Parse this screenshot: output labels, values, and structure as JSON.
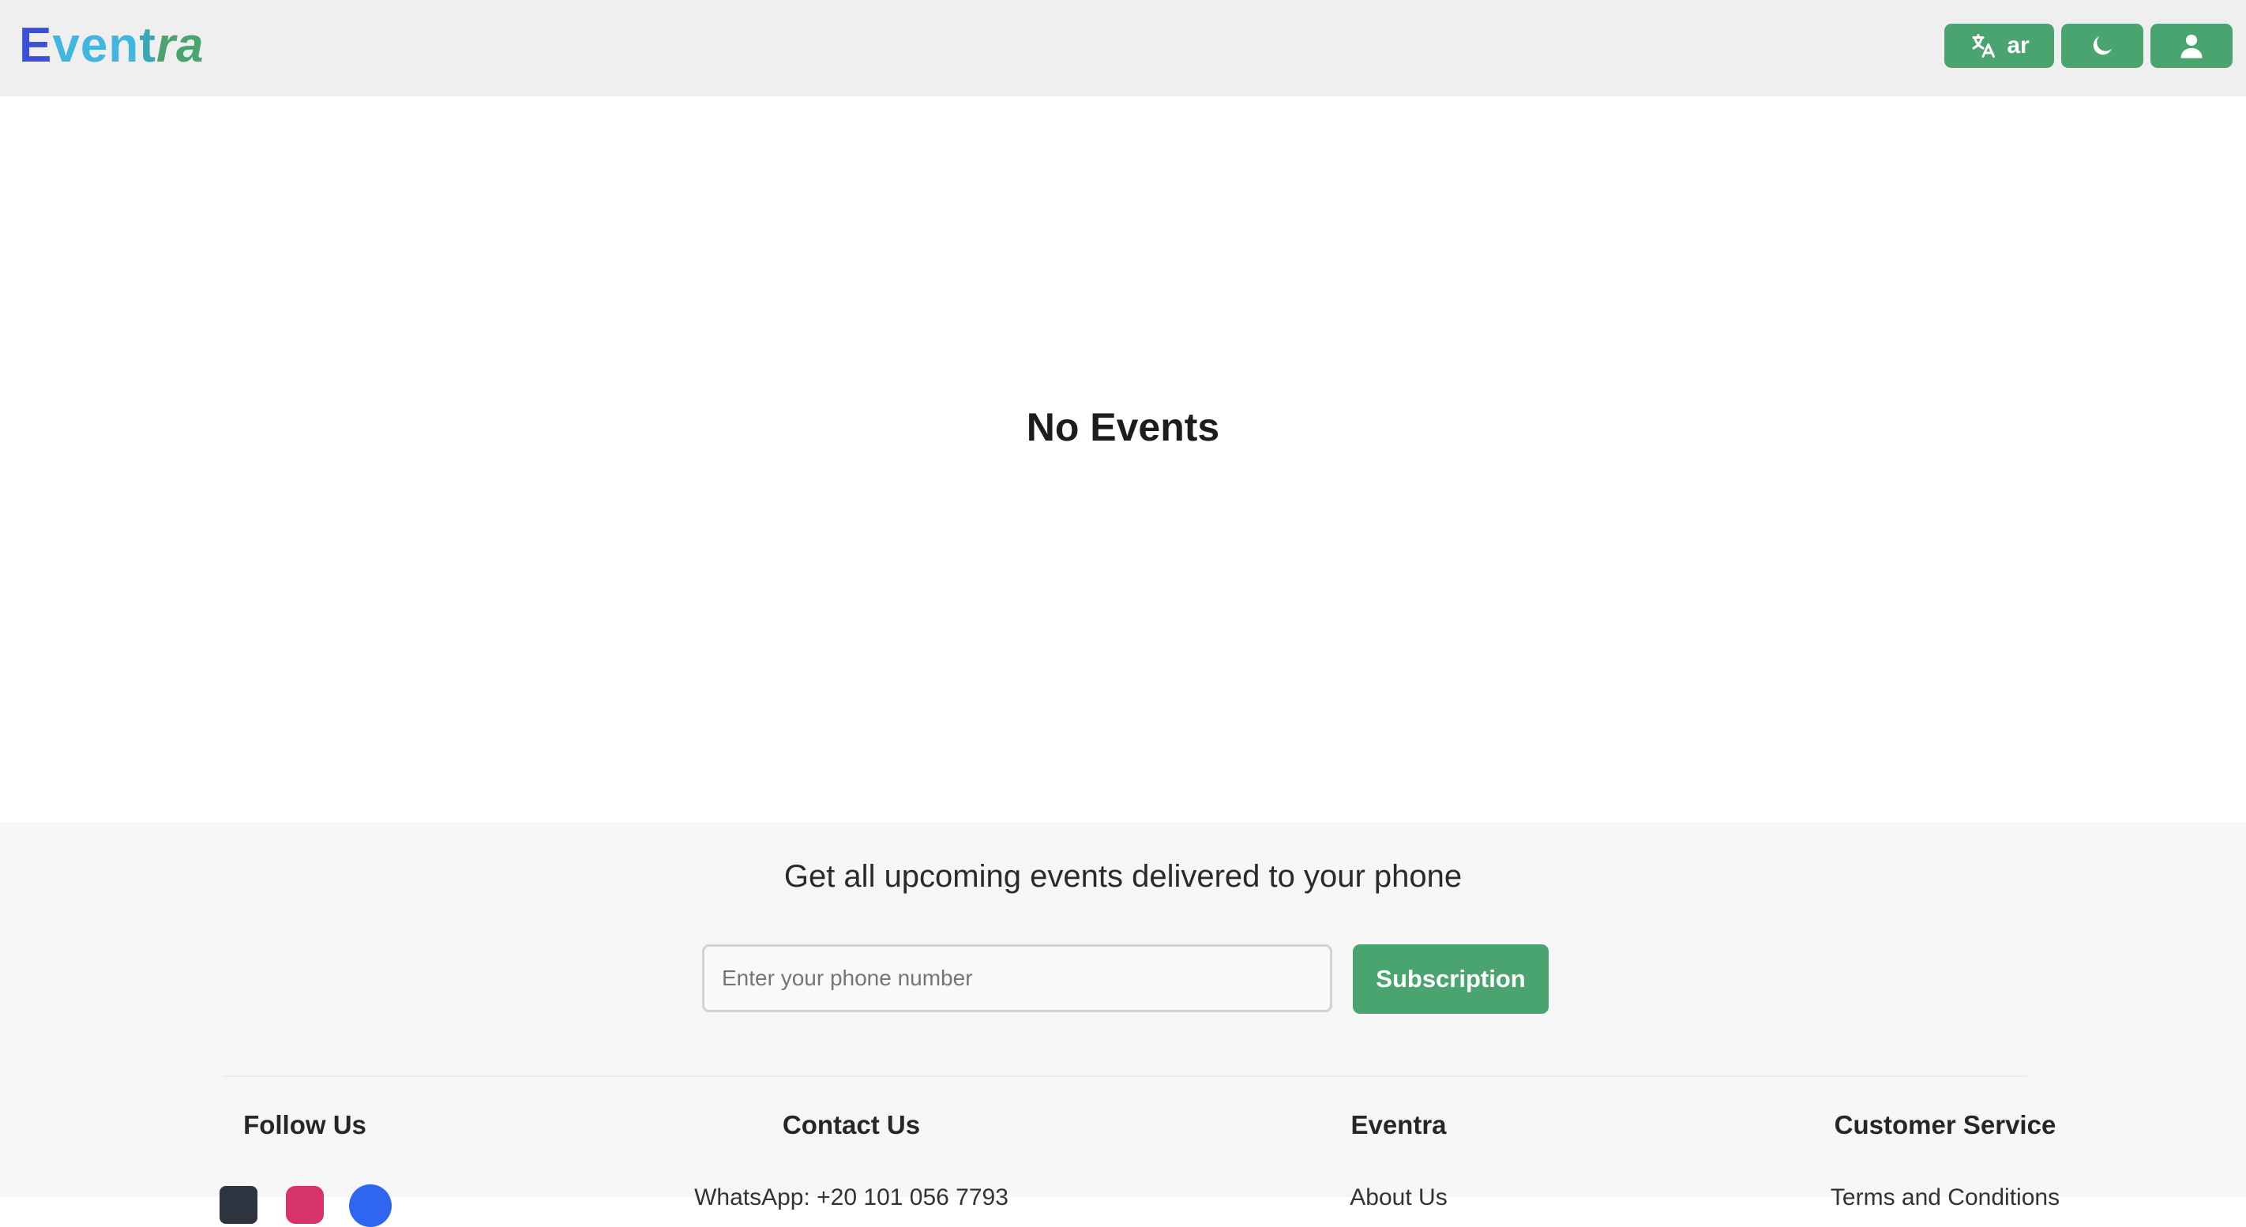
{
  "header": {
    "logo": {
      "letters": [
        {
          "char": "E",
          "color": "#3b50d8",
          "italic": false
        },
        {
          "char": "v",
          "color": "#41b6de",
          "italic": false
        },
        {
          "char": "e",
          "color": "#41b6de",
          "italic": false
        },
        {
          "char": "n",
          "color": "#41b6de",
          "italic": false
        },
        {
          "char": "t",
          "color": "#38a8b6",
          "italic": false
        },
        {
          "char": "r",
          "color": "#4aa46f",
          "italic": true
        },
        {
          "char": "a",
          "color": "#4aa46f",
          "italic": true
        }
      ]
    },
    "language_button": {
      "label": "ar",
      "icon": "translate-icon"
    },
    "theme_button": {
      "icon": "moon-icon"
    },
    "user_button": {
      "icon": "user-icon"
    }
  },
  "main": {
    "empty_state": "No Events"
  },
  "footer": {
    "subscribe": {
      "heading": "Get all upcoming events delivered to your phone",
      "phone_placeholder": "Enter your phone number",
      "button_label": "Subscription"
    },
    "columns": [
      {
        "title": "Follow Us"
      },
      {
        "title": "Contact Us",
        "first_item": "WhatsApp: +20 101 056 7793"
      },
      {
        "title": "Eventra",
        "first_item": "About Us"
      },
      {
        "title": "Customer Service",
        "first_item": "Terms and Conditions"
      }
    ],
    "social_icons": [
      "twitter-icon",
      "instagram-icon",
      "facebook-icon"
    ]
  },
  "colors": {
    "accent": "#4aa46f",
    "header_bg": "#efefef",
    "footer_bg": "#f6f6f6"
  }
}
